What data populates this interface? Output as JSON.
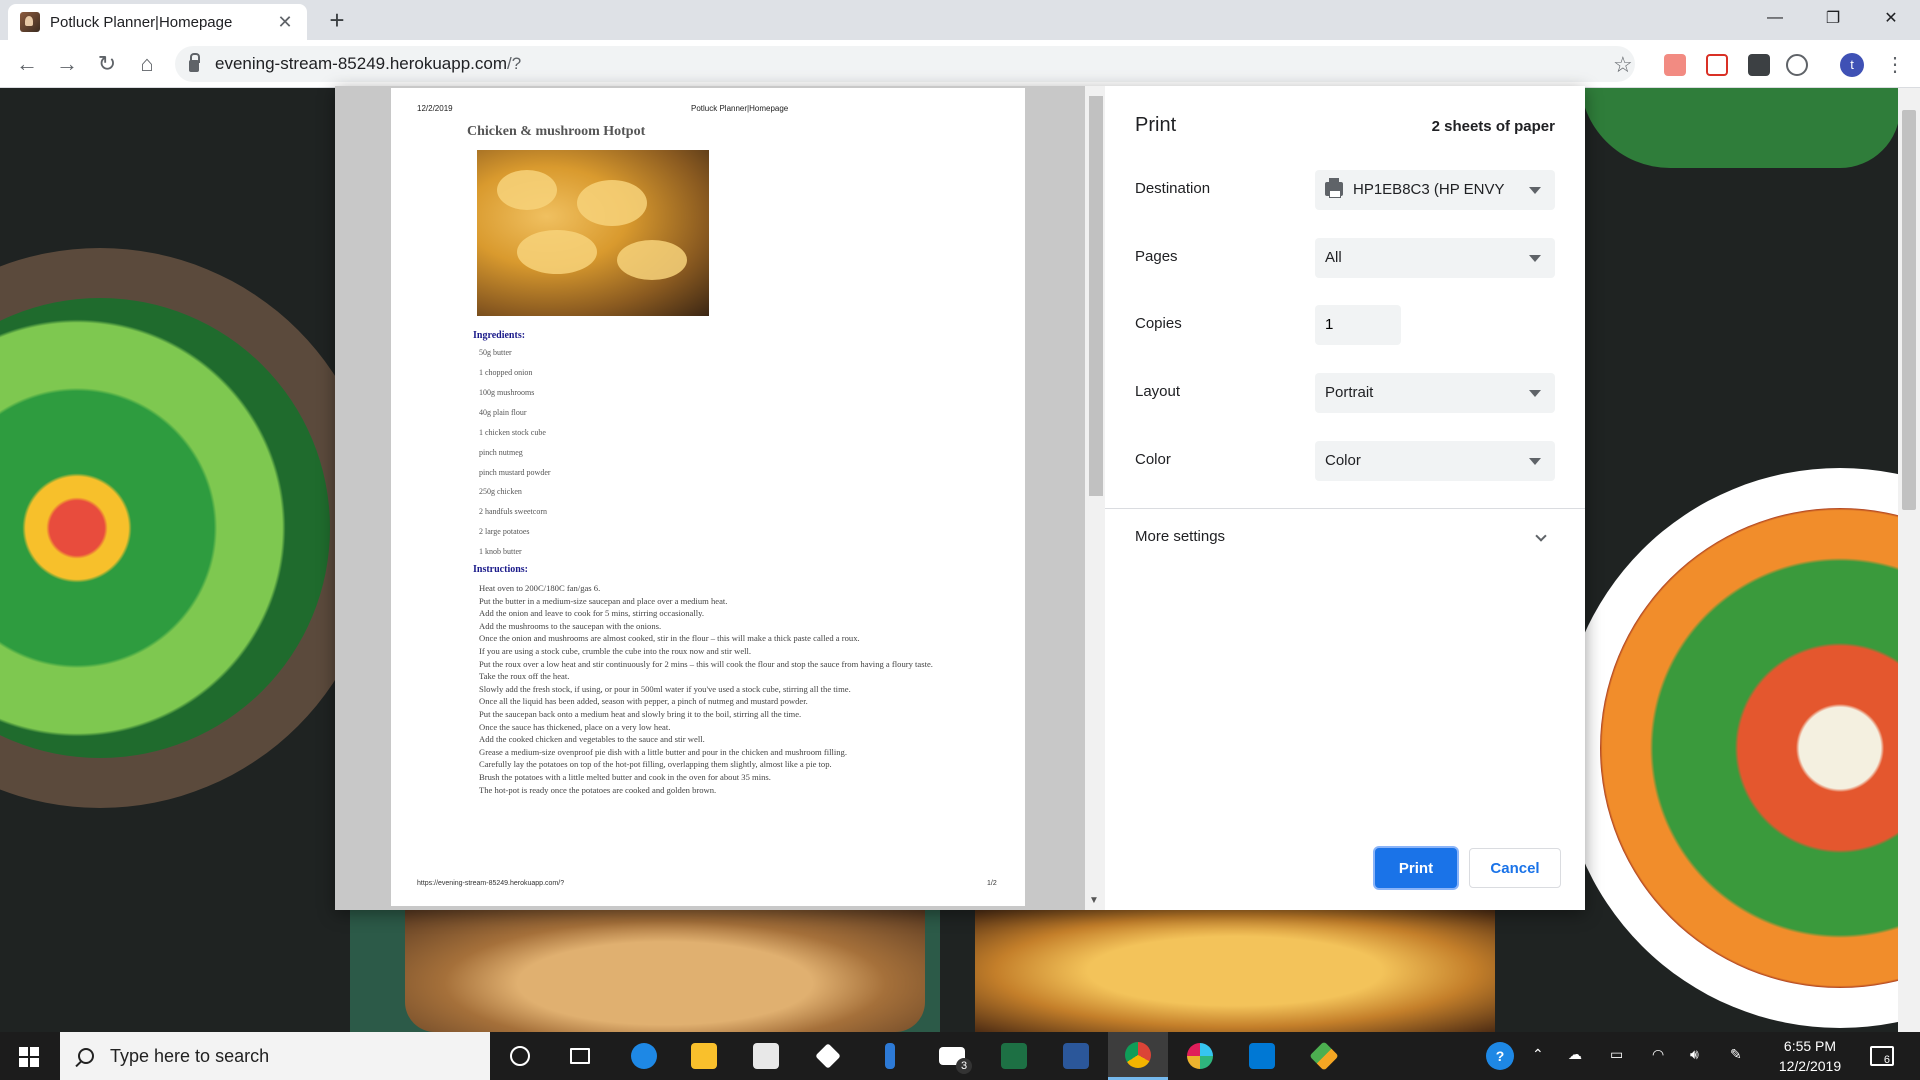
{
  "browser": {
    "tab_title": "Potluck Planner|Homepage",
    "url_host": "evening-stream-85249.herokuapp.com",
    "url_path": "/?"
  },
  "print_preview": {
    "header_date": "12/2/2019",
    "header_title": "Potluck Planner|Homepage",
    "recipe_title": "Chicken & mushroom Hotpot",
    "ingredients_heading": "Ingredients:",
    "ingredients": [
      "50g butter",
      "1 chopped onion",
      "100g mushrooms",
      "40g plain flour",
      "1 chicken stock cube",
      "pinch nutmeg",
      "pinch mustard powder",
      "250g chicken",
      "2 handfuls sweetcorn",
      "2 large potatoes",
      "1 knob butter"
    ],
    "instructions_heading": "Instructions:",
    "instructions": [
      "Heat oven to 200C/180C fan/gas 6.",
      "Put the butter in a medium-size saucepan and place over a medium heat.",
      "Add the onion and leave to cook for 5 mins, stirring occasionally.",
      "Add the mushrooms to the saucepan with the onions.",
      "Once the onion and mushrooms are almost cooked, stir in the flour – this will make a thick paste called a roux.",
      "If you are using a stock cube, crumble the cube into the roux now and stir well.",
      "Put the roux over a low heat and stir continuously for 2 mins – this will cook the flour and stop the sauce from having a floury taste.",
      "Take the roux off the heat.",
      "Slowly add the fresh stock, if using, or pour in 500ml water if you've used a stock cube, stirring all the time.",
      "Once all the liquid has been added, season with pepper, a pinch of nutmeg and mustard powder.",
      "Put the saucepan back onto a medium heat and slowly bring it to the boil, stirring all the time.",
      "Once the sauce has thickened, place on a very low heat.",
      "Add the cooked chicken and vegetables to the sauce and stir well.",
      "Grease a medium-size ovenproof pie dish with a little butter and pour in the chicken and mushroom filling.",
      "Carefully lay the potatoes on top of the hot-pot filling, overlapping them slightly, almost like a pie top.",
      "Brush the potatoes with a little melted butter and cook in the oven for about 35 mins.",
      "The hot-pot is ready once the potatoes are cooked and golden brown."
    ],
    "footer_url": "https://evening-stream-85249.herokuapp.com/?",
    "footer_page": "1/2"
  },
  "print_settings": {
    "title": "Print",
    "sheets": "2 sheets of paper",
    "destination_label": "Destination",
    "destination_value": "HP1EB8C3 (HP ENVY",
    "pages_label": "Pages",
    "pages_value": "All",
    "copies_label": "Copies",
    "copies_value": "1",
    "layout_label": "Layout",
    "layout_value": "Portrait",
    "color_label": "Color",
    "color_value": "Color",
    "more_settings": "More settings",
    "print_button": "Print",
    "cancel_button": "Cancel",
    "accent_color": "#1a73e8"
  },
  "taskbar": {
    "search_placeholder": "Type here to search",
    "time": "6:55 PM",
    "date": "12/2/2019",
    "mail_badge": "3",
    "notification_badge": "6"
  }
}
